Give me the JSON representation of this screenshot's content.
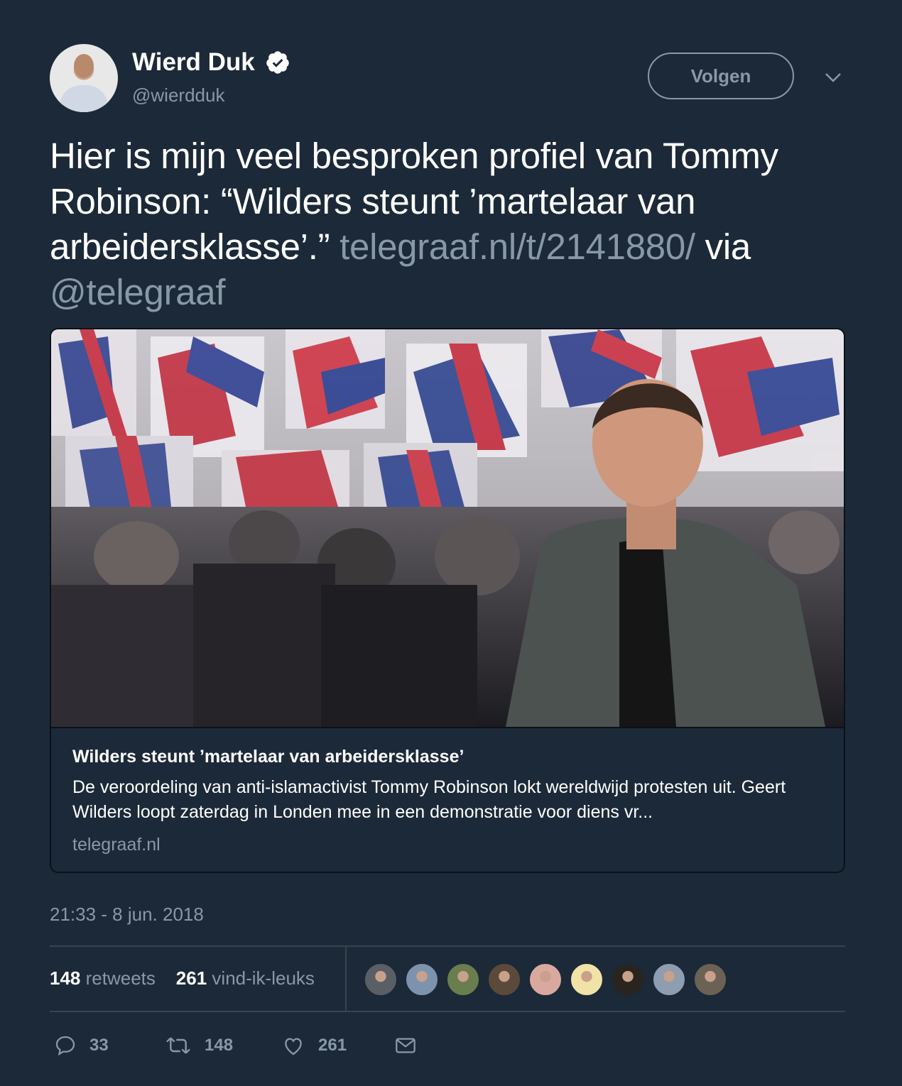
{
  "author": {
    "name": "Wierd Duk",
    "handle": "@wierdduk",
    "verified": true
  },
  "follow_button": {
    "label": "Volgen"
  },
  "tweet": {
    "text": "Hier is mijn veel besproken profiel van Tommy Robinson: “Wilders steunt ’martelaar van arbeidersklasse’.” ",
    "link": "telegraaf.nl/t/2141880/",
    "via_text": " via ",
    "mention": "@telegraaf"
  },
  "card": {
    "title": "Wilders steunt ’martelaar van arbeidersklasse’",
    "description": "De veroordeling van anti-islamactivist Tommy Robinson lokt wereldwijd protesten uit. Geert Wilders loopt zaterdag in Londen mee in een demonstratie voor diens vr...",
    "domain": "telegraaf.nl"
  },
  "timestamp": "21:33 - 8 jun. 2018",
  "stats": {
    "retweets_count": "148",
    "retweets_label": "retweets",
    "likes_count": "261",
    "likes_label": "vind-ik-leuks"
  },
  "likers": [
    {
      "color": "#5a5f66"
    },
    {
      "color": "#7d93ad"
    },
    {
      "color": "#6a7d4e"
    },
    {
      "color": "#5b4a3a"
    },
    {
      "color": "#d9a9a0"
    },
    {
      "color": "#f1e3a8"
    },
    {
      "color": "#2a2420"
    },
    {
      "color": "#8e9db0"
    },
    {
      "color": "#6b6255"
    }
  ],
  "actions": {
    "reply_count": "33",
    "retweet_count": "148",
    "like_count": "261"
  },
  "colors": {
    "background": "#1c2938",
    "muted": "#8899a6",
    "divider": "#38444d"
  }
}
